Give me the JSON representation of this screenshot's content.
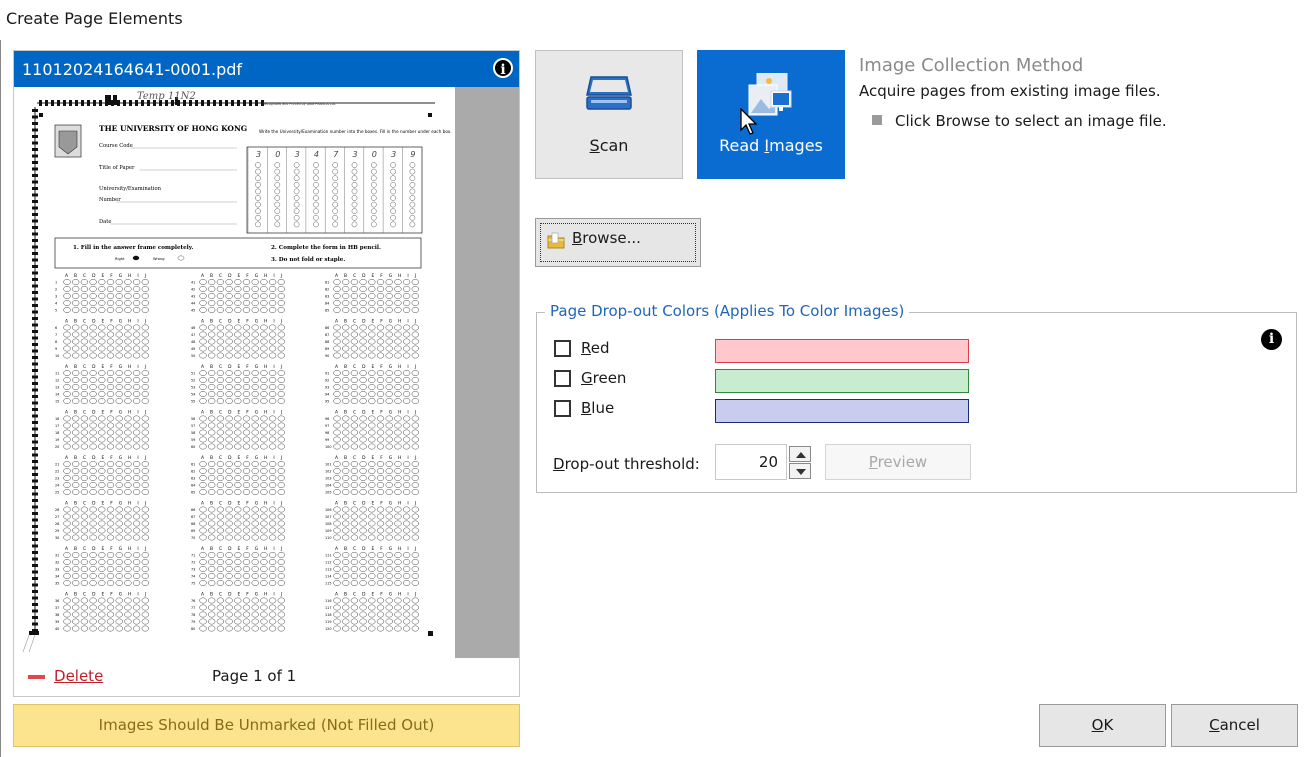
{
  "window": {
    "title": "Create Page Elements"
  },
  "document": {
    "filename": "11012024164641-0001.pdf",
    "info_icon": "info-icon",
    "delete": {
      "prefix": "",
      "key": "D",
      "rest": "elete"
    },
    "page_label": "Page 1 of 1",
    "sheet": {
      "handwriting": "Temp 11N2",
      "header_small": "Recognised and Printed by Data Products Ltd.",
      "university": "THE UNIVERSITY OF HONG KONG",
      "fields": [
        "Course Code",
        "Title of Paper",
        "University/Examination",
        "Number",
        "Date"
      ],
      "instruction_top": "Write the University/Examination number into the boxes. Fill in the number under each box.",
      "handwritten_digits": [
        "3",
        "0",
        "3",
        "4",
        "7",
        "3",
        "0",
        "3",
        "9"
      ],
      "instructions": [
        "1. Fill in the answer frame completely.",
        "2. Complete the form in HB pencil.",
        "3. Do not fold or staple."
      ],
      "right_label": "Right",
      "wrong_label": "Wrong",
      "letters": "A B C D E F G H I J",
      "col_starts": [
        "1",
        "41",
        "81"
      ]
    }
  },
  "warning": "Images Should Be Unmarked (Not Filled Out)",
  "buttons": {
    "scan": {
      "key": "S",
      "rest": "can",
      "icon": "scanner-icon"
    },
    "read_images": {
      "before": "Read ",
      "key": "I",
      "after": "mages",
      "icon": "image-file-icon"
    },
    "browse": {
      "key": "B",
      "rest": "rowse...",
      "icon": "folder-icon"
    },
    "ok": {
      "key": "O",
      "rest": "K"
    },
    "cancel": {
      "key": "C",
      "rest": "ancel"
    }
  },
  "method": {
    "title": "Image Collection Method",
    "description": "Acquire pages from existing image files.",
    "hint": "Click Browse to select an image file."
  },
  "dropout": {
    "legend": "Page Drop-out Colors (Applies To Color Images)",
    "colors": [
      {
        "key": "R",
        "rest": "ed",
        "checked": false,
        "fill": "#ffc8cc",
        "border": "#d9404b"
      },
      {
        "key": "G",
        "rest": "reen",
        "checked": false,
        "fill": "#c8eccf",
        "border": "#2f8a3f"
      },
      {
        "key": "B",
        "rest": "lue",
        "checked": false,
        "fill": "#c8cdf0",
        "border": "#1e2a7a"
      }
    ],
    "threshold_label": {
      "key": "D",
      "rest": "rop-out threshold:"
    },
    "threshold_value": "20",
    "preview": {
      "key": "P",
      "rest": "review",
      "enabled": false
    }
  },
  "colors": {
    "accent": "#0066c4",
    "warning_bg": "#fbe48d",
    "delete": "#e4464f"
  }
}
